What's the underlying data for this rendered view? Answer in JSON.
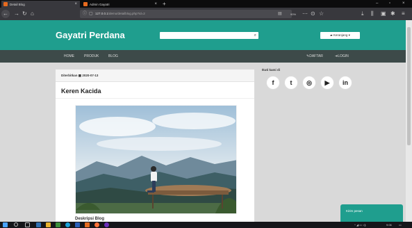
{
  "browser": {
    "tabs": [
      {
        "title": "Detail Blog",
        "active": true
      },
      {
        "title": "Admin Gayatri",
        "active": false
      }
    ],
    "new_tab": "+",
    "url_host": "127.0.0.1",
    "url_path": "/demo/detailblog.php?id=2",
    "zoom": "90%"
  },
  "site": {
    "brand": "Gayatri Perdana",
    "search_placeholder": "",
    "cart_label": "Keranjang",
    "nav": {
      "home": "HOME",
      "produk": "PRODUK",
      "blog": "BLOG",
      "daftar": "DAFTAR",
      "login": "LOGIN"
    }
  },
  "article": {
    "meta_prefix": "Diterbitkan",
    "date": "2020-07-13",
    "title": "Keren Kacida",
    "caption": "Deskripsi Blog"
  },
  "sidebar": {
    "follow_title": "Ikuti kami di",
    "social": [
      {
        "icon": "facebook-icon",
        "glyph": "f"
      },
      {
        "icon": "twitter-icon",
        "glyph": "t"
      },
      {
        "icon": "instagram-icon",
        "glyph": "◎"
      },
      {
        "icon": "youtube-icon",
        "glyph": "▶"
      },
      {
        "icon": "linkedin-icon",
        "glyph": "in"
      }
    ]
  },
  "chat": {
    "label": "Kirim pesan"
  },
  "taskbar": {
    "time": "9:06"
  },
  "colors": {
    "accent": "#1f9e8e",
    "nav_dark": "#3d4a49",
    "page_bg": "#d9d9d9"
  }
}
